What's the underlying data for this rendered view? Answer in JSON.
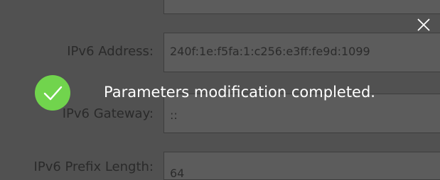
{
  "form": {
    "ipv6_address": {
      "label": "IPv6 Address:",
      "value": "240f:1e:f5fa:1:c256:e3ff:fe9d:1099"
    },
    "ipv6_gateway": {
      "label": "IPv6 Gateway:",
      "value": "::"
    },
    "ipv6_prefix_length": {
      "label": "IPv6 Prefix Length:",
      "value": "64"
    }
  },
  "toast": {
    "message": "Parameters modification completed.",
    "icon": "check-circle-icon",
    "icon_color": "#71d44d"
  },
  "close_icon": "close-icon",
  "colors": {
    "overlay": "#515151",
    "toast_text": "#ffffff"
  }
}
